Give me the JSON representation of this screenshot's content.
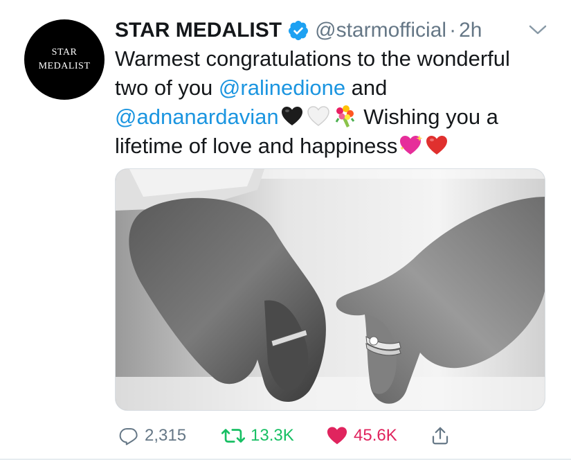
{
  "tweet": {
    "avatar": {
      "line1": "STAR",
      "line2": "MEDALIST"
    },
    "header": {
      "display_name": "STAR MEDALIST",
      "handle": "@starmofficial",
      "separator": "·",
      "time": "2h",
      "verified_icon": "verified-badge-icon",
      "menu_icon": "chevron-down-icon"
    },
    "text": {
      "line1": "Warmest congratulations to the wonderful",
      "line2_prefix": "two of you ",
      "mention1": "@ralinedione",
      "line2_suffix": " and",
      "mention2": "@adnanardavian",
      "line3_suffix": " Wishing you a",
      "line4": "lifetime of love and happiness",
      "emojis": [
        "black-heart-emoji",
        "white-heart-emoji",
        "bouquet-emoji",
        "sparkling-heart-emoji",
        "red-heart-emoji"
      ]
    },
    "media": {
      "description_icon": "photo-holding-hands-rings"
    },
    "actions": {
      "reply_count": "2,315",
      "retweet_count": "13.3K",
      "like_count": "45.6K",
      "reply_icon": "reply-icon",
      "retweet_icon": "retweet-icon",
      "like_icon": "heart-icon",
      "share_icon": "share-icon"
    },
    "colors": {
      "link": "#1b95e0",
      "secondary": "#657786",
      "retweet": "#17bf63",
      "like": "#e0245e",
      "verified": "#1da1f2"
    }
  }
}
